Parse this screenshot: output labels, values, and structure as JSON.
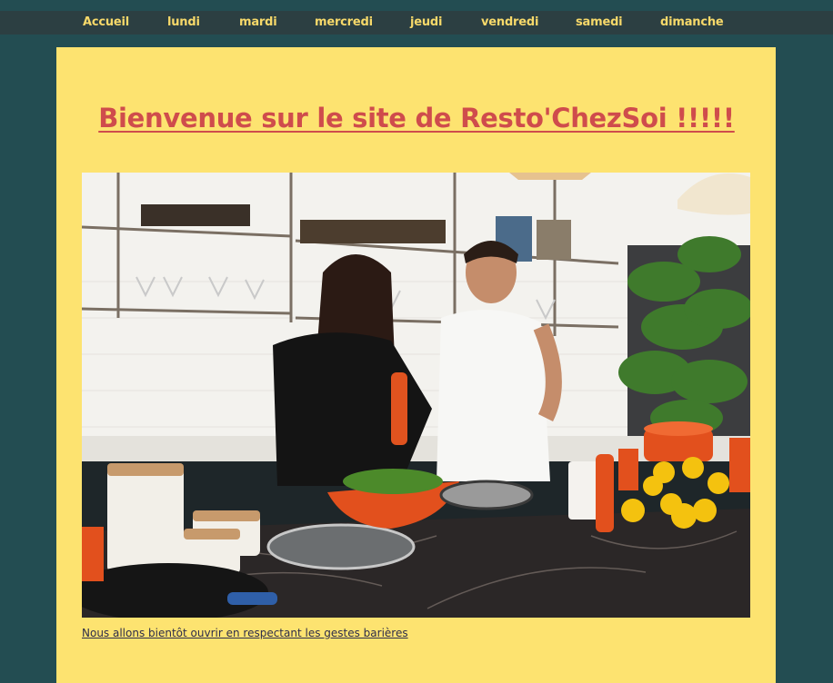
{
  "nav": {
    "items": [
      "Accueil",
      "lundi",
      "mardi",
      "mercredi",
      "jeudi",
      "vendredi",
      "samedi",
      "dimanche"
    ]
  },
  "main": {
    "title": "Bienvenue sur le site de Resto'ChezSoi !!!!!",
    "caption": "Nous allons bientôt ouvrir en respectant les gestes barières"
  },
  "colors": {
    "background": "#234d52",
    "nav_bar": "#2c3f42",
    "nav_text": "#f7d96a",
    "card": "#fde370",
    "title": "#cf4c4c",
    "caption": "#2d2d4a"
  }
}
